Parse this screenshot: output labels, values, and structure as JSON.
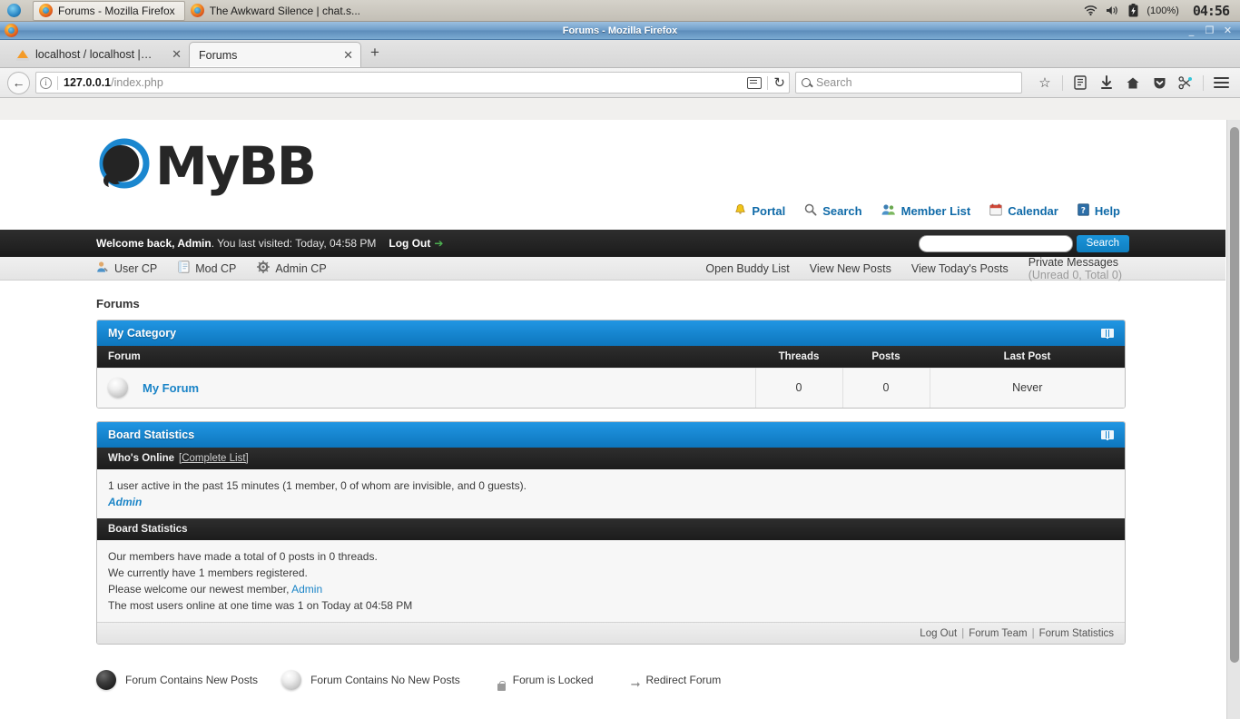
{
  "os_panel": {
    "launcher_icon": "firefox-launcher-icon",
    "tasks": [
      {
        "icon": "firefox-icon",
        "label": "Forums - Mozilla Firefox",
        "active": true
      },
      {
        "icon": "firefox-icon",
        "label": "The Awkward Silence | chat.s...",
        "active": false
      }
    ],
    "tray": {
      "wifi_icon": "wifi-icon",
      "volume_icon": "volume-icon",
      "battery_icon": "battery-charging-icon",
      "battery_label": "(100%)",
      "clock": "04:56"
    }
  },
  "window": {
    "title": "Forums - Mozilla Firefox",
    "minimize_label": "_",
    "restore_label": "❐",
    "close_label": "✕"
  },
  "browser": {
    "tabs": [
      {
        "icon": "phpmyadmin-icon",
        "title": "localhost / localhost | phpM",
        "close_label": "✕",
        "active": false
      },
      {
        "icon": "page-icon",
        "title": "Forums",
        "close_label": "✕",
        "active": true
      }
    ],
    "new_tab_label": "+",
    "back_icon": "back-arrow-icon",
    "url": {
      "host": "127.0.0.1",
      "path": "/index.php",
      "info_icon": "info-icon"
    },
    "reader_icon": "reader-mode-icon",
    "reload_icon": "reload-icon",
    "search": {
      "placeholder": "Search",
      "icon": "search-icon"
    },
    "toolbar_icons": [
      {
        "name": "bookmark-star-icon",
        "glyph": "☆"
      },
      {
        "name": "library-icon",
        "glyph": "☰"
      },
      {
        "name": "downloads-icon",
        "glyph": "↓"
      },
      {
        "name": "home-icon",
        "glyph": "⌂"
      },
      {
        "name": "pocket-icon",
        "glyph": "▼"
      },
      {
        "name": "screenshot-icon",
        "glyph": "✂"
      },
      {
        "name": "menu-icon",
        "glyph": "☰"
      }
    ]
  },
  "site": {
    "logo_text": "MyBB",
    "topnav": [
      {
        "label": "Portal",
        "icon": "bell-icon"
      },
      {
        "label": "Search",
        "icon": "search-icon"
      },
      {
        "label": "Member List",
        "icon": "members-icon"
      },
      {
        "label": "Calendar",
        "icon": "calendar-icon"
      },
      {
        "label": "Help",
        "icon": "help-icon"
      }
    ],
    "welcome": {
      "greeting": "Welcome back, Admin",
      "last_visit": ". You last visited: Today, 04:58 PM",
      "logout_label": "Log Out",
      "logout_arrow": "➔",
      "search_value": "",
      "search_button": "Search"
    },
    "menu": {
      "left": [
        {
          "label": "User CP",
          "icon": "user-cp-icon"
        },
        {
          "label": "Mod CP",
          "icon": "mod-cp-icon"
        },
        {
          "label": "Admin CP",
          "icon": "admin-cp-icon"
        }
      ],
      "right": [
        {
          "label": "Open Buddy List",
          "note": ""
        },
        {
          "label": "View New Posts",
          "note": ""
        },
        {
          "label": "View Today's Posts",
          "note": ""
        },
        {
          "label": "Private Messages",
          "note": "(Unread 0, Total 0)"
        }
      ]
    },
    "breadcrumb": "Forums",
    "category": {
      "title": "My Category",
      "collapse_icon": "collapse-toggle-icon",
      "columns": [
        "Forum",
        "Threads",
        "Posts",
        "Last Post"
      ],
      "rows": [
        {
          "status_icon": "forum-no-new-posts-icon",
          "name": "My Forum",
          "threads": "0",
          "posts": "0",
          "last_post": "Never"
        }
      ]
    },
    "board_statistics": {
      "title": "Board Statistics",
      "collapse_icon": "collapse-toggle-icon",
      "whos_online": {
        "heading": "Who's Online",
        "complete_list": "[Complete List]",
        "summary": "1 user active in the past 15 minutes (1 member, 0 of whom are invisible, and 0 guests).",
        "users": [
          "Admin"
        ]
      },
      "stats": {
        "heading": "Board Statistics",
        "lines": [
          "Our members have made a total of 0 posts in 0 threads.",
          "We currently have 1 members registered.",
          "The most users online at one time was 1 on Today at 04:58 PM"
        ],
        "newest_member_prefix": "Please welcome our newest member,",
        "newest_member": "Admin"
      },
      "footer": [
        {
          "label": "Log Out"
        },
        {
          "label": "Forum Team"
        },
        {
          "label": "Forum Statistics"
        }
      ],
      "footer_separator": "|"
    },
    "legend": [
      {
        "label": "Forum Contains New Posts",
        "icon": "forum-new-posts-icon"
      },
      {
        "label": "Forum Contains No New Posts",
        "icon": "forum-no-new-posts-icon"
      },
      {
        "label": "Forum is Locked",
        "icon": "forum-locked-icon"
      },
      {
        "label": "Redirect Forum",
        "icon": "forum-redirect-icon"
      }
    ]
  },
  "colors": {
    "accent_blue": "#0d76bd",
    "link_blue": "#1a84c7",
    "dark_bar": "#1c1c1c",
    "online_green": "#2e7d32"
  }
}
